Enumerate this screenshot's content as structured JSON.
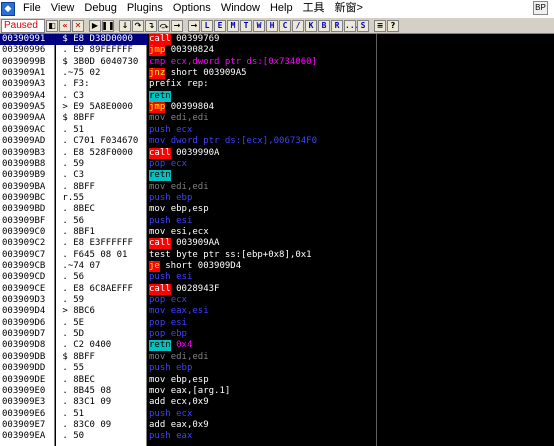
{
  "menu": {
    "items": [
      "File",
      "View",
      "Debug",
      "Plugins",
      "Options",
      "Window",
      "Help",
      "工具",
      "新窗>"
    ],
    "bp_label": "BP"
  },
  "toolbar": {
    "status": "Paused",
    "letters": [
      "L",
      "E",
      "M",
      "T",
      "W",
      "H",
      "C",
      "/",
      "K",
      "B",
      "R",
      "...",
      "S"
    ]
  },
  "colors": {
    "call": {
      "bg": "#ff0000",
      "fg": "#ffffff"
    },
    "jmp": {
      "bg": "#ff0000",
      "fg": "#ffff00"
    },
    "ret": {
      "bg": "#00c0c0",
      "fg": "#000000"
    },
    "highlight": "#ff00ff",
    "mov": "#808080",
    "push": "#4040ff",
    "normal": "#ffffff"
  },
  "rows": [
    {
      "addr": "00390991",
      "mk": " $ ",
      "hex": "E8 D38D0000",
      "mn": "call",
      "op": "00399769",
      "cls": "call",
      "sel": true
    },
    {
      "addr": "00390996",
      "mk": " . ",
      "hex": "E9 89FEFFFF",
      "mn": "jmp",
      "op": "00390824",
      "cls": "jmp"
    },
    {
      "addr": "0039099B",
      "mk": " $ ",
      "hex": "3B0D 6040730",
      "mn": "cmp",
      "op": "ecx,dword ptr ds:[0x734060]",
      "cls": "pink"
    },
    {
      "addr": "003909A1",
      "mk": " .~",
      "hex": "75 02",
      "mn": "jnz",
      "op": "short 003909A5",
      "cls": "jmp"
    },
    {
      "addr": "003909A3",
      "mk": " . ",
      "hex": "F3:",
      "mn": "prefix rep:",
      "op": "",
      "cls": "white"
    },
    {
      "addr": "003909A4",
      "mk": " . ",
      "hex": "C3",
      "mn": "retn",
      "op": "",
      "cls": "ret"
    },
    {
      "addr": "003909A5",
      "mk": " > ",
      "hex": "E9 5A8E0000",
      "mn": "jmp",
      "op": "00399804",
      "cls": "jmp"
    },
    {
      "addr": "003909AA",
      "mk": " $ ",
      "hex": "8BFF",
      "mn": "mov",
      "op": "edi,edi",
      "cls": "gray"
    },
    {
      "addr": "003909AC",
      "mk": " . ",
      "hex": "51",
      "mn": "push",
      "op": "ecx",
      "cls": "blue"
    },
    {
      "addr": "003909AD",
      "mk": " . ",
      "hex": "C701 F034670",
      "mn": "mov",
      "op": "dword ptr ds:[ecx],006734F0",
      "cls": "blue"
    },
    {
      "addr": "003909B3",
      "mk": " . ",
      "hex": "E8 528F0000",
      "mn": "call",
      "op": "0039990A",
      "cls": "call"
    },
    {
      "addr": "003909B8",
      "mk": " . ",
      "hex": "59",
      "mn": "pop",
      "op": "ecx",
      "cls": "blue"
    },
    {
      "addr": "003909B9",
      "mk": " . ",
      "hex": "C3",
      "mn": "retn",
      "op": "",
      "cls": "ret"
    },
    {
      "addr": "003909BA",
      "mk": " . ",
      "hex": "8BFF",
      "mn": "mov",
      "op": "edi,edi",
      "cls": "gray"
    },
    {
      "addr": "003909BC",
      "mk": " r.",
      "hex": "55",
      "mn": "push",
      "op": "ebp",
      "cls": "blue"
    },
    {
      "addr": "003909BD",
      "mk": " . ",
      "hex": "8BEC",
      "mn": "mov",
      "op": "ebp,esp",
      "cls": "white"
    },
    {
      "addr": "003909BF",
      "mk": " . ",
      "hex": "56",
      "mn": "push",
      "op": "esi",
      "cls": "blue"
    },
    {
      "addr": "003909C0",
      "mk": " . ",
      "hex": "8BF1",
      "mn": "mov",
      "op": "esi,ecx",
      "cls": "white"
    },
    {
      "addr": "003909C2",
      "mk": " . ",
      "hex": "E8 E3FFFFFF",
      "mn": "call",
      "op": "003909AA",
      "cls": "call"
    },
    {
      "addr": "003909C7",
      "mk": " . ",
      "hex": "F645 08 01",
      "mn": "test",
      "op": "byte ptr ss:[ebp+0x8],0x1",
      "cls": "white"
    },
    {
      "addr": "003909CB",
      "mk": " .~",
      "hex": "74 07",
      "mn": "je",
      "op": "short 003909D4",
      "cls": "jmp"
    },
    {
      "addr": "003909CD",
      "mk": " . ",
      "hex": "56",
      "mn": "push",
      "op": "esi",
      "cls": "blue"
    },
    {
      "addr": "003909CE",
      "mk": " . ",
      "hex": "E8 6C8AEFFF",
      "mn": "call",
      "op": "0028943F",
      "cls": "call"
    },
    {
      "addr": "003909D3",
      "mk": " . ",
      "hex": "59",
      "mn": "pop",
      "op": "ecx",
      "cls": "blue"
    },
    {
      "addr": "003909D4",
      "mk": " > ",
      "hex": "8BC6",
      "mn": "mov",
      "op": "eax,esi",
      "cls": "white"
    },
    {
      "addr": "003909D6",
      "mk": " . ",
      "hex": "5E",
      "mn": "pop",
      "op": "esi",
      "cls": "blue"
    },
    {
      "addr": "003909D7",
      "mk": " . ",
      "hex": "5D",
      "mn": "pop",
      "op": "ebp",
      "cls": "blue"
    },
    {
      "addr": "003909D8",
      "mk": " . ",
      "hex": "C2 0400",
      "mn": "retn",
      "op": "0x4",
      "cls": "ret"
    },
    {
      "addr": "003909DB",
      "mk": " $ ",
      "hex": "8BFF",
      "mn": "mov",
      "op": "edi,edi",
      "cls": "gray"
    },
    {
      "addr": "003909DD",
      "mk": " . ",
      "hex": "55",
      "mn": "push",
      "op": "ebp",
      "cls": "blue"
    },
    {
      "addr": "003909DE",
      "mk": " . ",
      "hex": "8BEC",
      "mn": "mov",
      "op": "ebp,esp",
      "cls": "white"
    },
    {
      "addr": "003909E0",
      "mk": " . ",
      "hex": "8B45 08",
      "mn": "mov",
      "op": "eax,[arg.1]",
      "cls": "white"
    },
    {
      "addr": "003909E3",
      "mk": " . ",
      "hex": "83C1 09",
      "mn": "add",
      "op": "ecx,0x9",
      "cls": "white"
    },
    {
      "addr": "003909E6",
      "mk": " . ",
      "hex": "51",
      "mn": "push",
      "op": "ecx",
      "cls": "blue"
    },
    {
      "addr": "003909E7",
      "mk": " . ",
      "hex": "83C0 09",
      "mn": "add",
      "op": "eax,0x9",
      "cls": "white"
    },
    {
      "addr": "003909EA",
      "mk": " . ",
      "hex": "50",
      "mn": "push",
      "op": "eax",
      "cls": "blue"
    }
  ]
}
